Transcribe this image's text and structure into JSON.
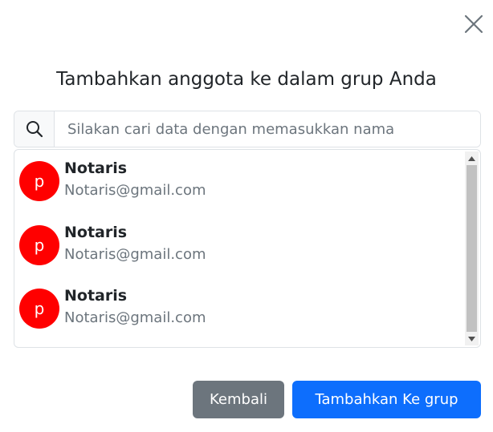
{
  "modal": {
    "title": "Tambahkan anggota ke dalam grup Anda",
    "close_icon": "close-icon"
  },
  "search": {
    "placeholder": "Silakan cari data dengan memasukkan nama",
    "value": "",
    "icon": "search-icon"
  },
  "members": [
    {
      "initial": "p",
      "name": "Notaris",
      "email": "Notaris@gmail.com"
    },
    {
      "initial": "p",
      "name": "Notaris",
      "email": "Notaris@gmail.com"
    },
    {
      "initial": "p",
      "name": "Notaris",
      "email": "Notaris@gmail.com"
    }
  ],
  "buttons": {
    "back_label": "Kembali",
    "add_label": "Tambahkan Ke grup"
  },
  "colors": {
    "avatar": "#ff0000",
    "back_button": "#6c757d",
    "primary_button": "#0d6efd"
  }
}
